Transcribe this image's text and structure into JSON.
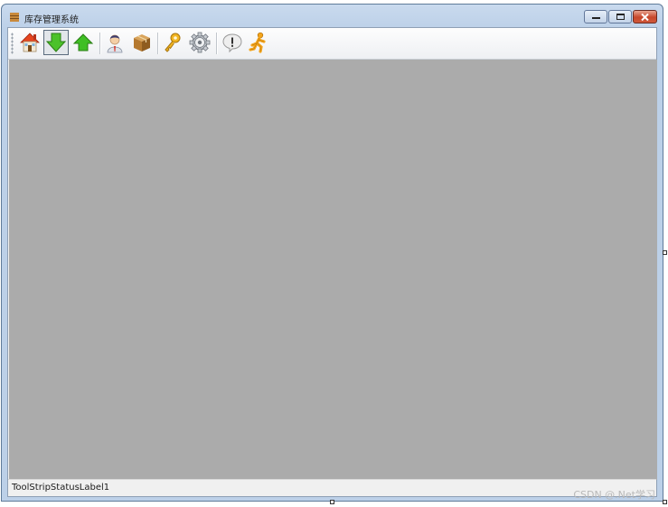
{
  "window": {
    "title": "库存管理系统",
    "controls": [
      "minimize",
      "maximize",
      "close"
    ]
  },
  "toolbar": {
    "buttons": [
      {
        "name": "home",
        "icon": "home-icon",
        "pressed": false
      },
      {
        "name": "download",
        "icon": "arrow-down-icon",
        "pressed": true
      },
      {
        "name": "upload",
        "icon": "arrow-up-icon",
        "pressed": false
      },
      {
        "name": "user",
        "icon": "user-icon",
        "pressed": false
      },
      {
        "name": "package",
        "icon": "package-box-icon",
        "pressed": false
      },
      {
        "name": "key",
        "icon": "key-icon",
        "pressed": false
      },
      {
        "name": "settings",
        "icon": "gear-icon",
        "pressed": false
      },
      {
        "name": "alert",
        "icon": "alert-bubble-icon",
        "pressed": false
      },
      {
        "name": "exit",
        "icon": "running-man-icon",
        "pressed": false
      }
    ]
  },
  "status": {
    "label": "ToolStripStatusLabel1"
  },
  "watermark": "CSDN @.Net学习",
  "colors": {
    "mdi_background": "#ababab",
    "toolbar_background": "#f5f6f8",
    "title_bar": "#c9daee"
  }
}
